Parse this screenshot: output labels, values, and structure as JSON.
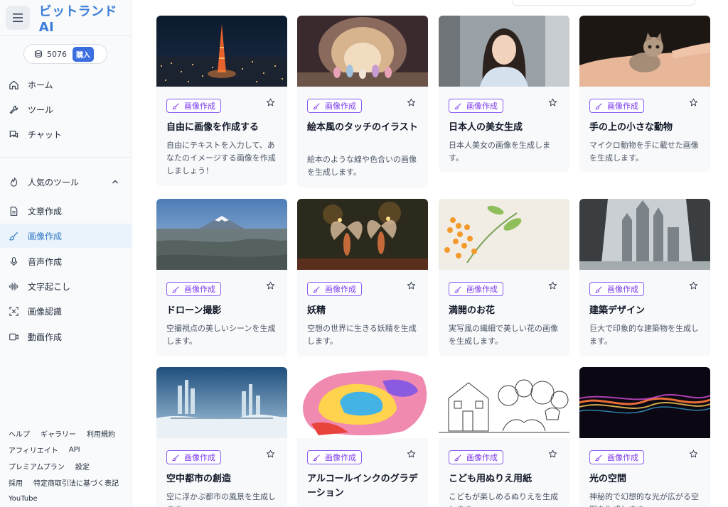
{
  "brand": {
    "name": "ビットランドAI"
  },
  "credits": {
    "amount": "5076",
    "buy_label": "購入"
  },
  "nav": {
    "main": [
      {
        "label": "ホーム",
        "icon": "home-icon"
      },
      {
        "label": "ツール",
        "icon": "wrench-icon"
      },
      {
        "label": "チャット",
        "icon": "chat-icon"
      }
    ],
    "popular_header": "人気のツール",
    "popular": [
      {
        "label": "文章作成",
        "icon": "document-icon"
      },
      {
        "label": "画像作成",
        "icon": "brush-icon",
        "active": true
      },
      {
        "label": "音声作成",
        "icon": "microphone-icon"
      },
      {
        "label": "文字起こし",
        "icon": "waveform-icon"
      },
      {
        "label": "画像認識",
        "icon": "scan-icon"
      },
      {
        "label": "動画作成",
        "icon": "video-icon"
      }
    ]
  },
  "footer": {
    "row1": [
      "ヘルプ",
      "ギャラリー",
      "利用規約"
    ],
    "row2": [
      "アフィリエイト",
      "API"
    ],
    "row3": [
      "プレミアムプラン",
      "設定"
    ],
    "row4": [
      "採用",
      "特定商取引法に基づく表記"
    ],
    "row5": [
      "YouTube"
    ]
  },
  "cards": [
    {
      "tag": "画像作成",
      "title": "自由に画像を作成する",
      "desc": "自由にテキストを入力して、あなたのイメージする画像を作成しましょう！",
      "image": "tokyo-tower-night"
    },
    {
      "tag": "画像作成",
      "title": "絵本風のタッチのイラスト",
      "desc": "絵本のような線や色合いの画像を生成します。",
      "image": "storybook-cave"
    },
    {
      "tag": "画像作成",
      "title": "日本人の美女生成",
      "desc": "日本人美女の画像を生成します。",
      "image": "portrait-woman"
    },
    {
      "tag": "画像作成",
      "title": "手の上の小さな動物",
      "desc": "マイクロ動物を手に載せた画像を生成します。",
      "image": "kitten-in-hand"
    },
    {
      "tag": "画像作成",
      "title": "ドローン撮影",
      "desc": "空撮視点の美しいシーンを生成します。",
      "image": "mount-fuji-aerial"
    },
    {
      "tag": "画像作成",
      "title": "妖精",
      "desc": "空想の世界に生きる妖精を生成します。",
      "image": "fairies"
    },
    {
      "tag": "画像作成",
      "title": "満開のお花",
      "desc": "実写風の繊細で美しい花の画像を生成します。",
      "image": "orange-blossoms"
    },
    {
      "tag": "画像作成",
      "title": "建築デザイン",
      "desc": "巨大で印象的な建築物を生成します。",
      "image": "gothic-architecture"
    },
    {
      "tag": "画像作成",
      "title": "空中都市の創造",
      "desc": "空に浮かぶ都市の風景を生成します。",
      "image": "sky-city"
    },
    {
      "tag": "画像作成",
      "title": "アルコールインクのグラデーション",
      "desc": "",
      "image": "alcohol-ink"
    },
    {
      "tag": "画像作成",
      "title": "こども用ぬりえ用紙",
      "desc": "こどもが楽しめるぬりえを生成します。",
      "image": "coloring-page"
    },
    {
      "tag": "画像作成",
      "title": "光の空間",
      "desc": "神秘的で幻想的な光が広がる空間を生成します。",
      "image": "light-space"
    }
  ]
}
